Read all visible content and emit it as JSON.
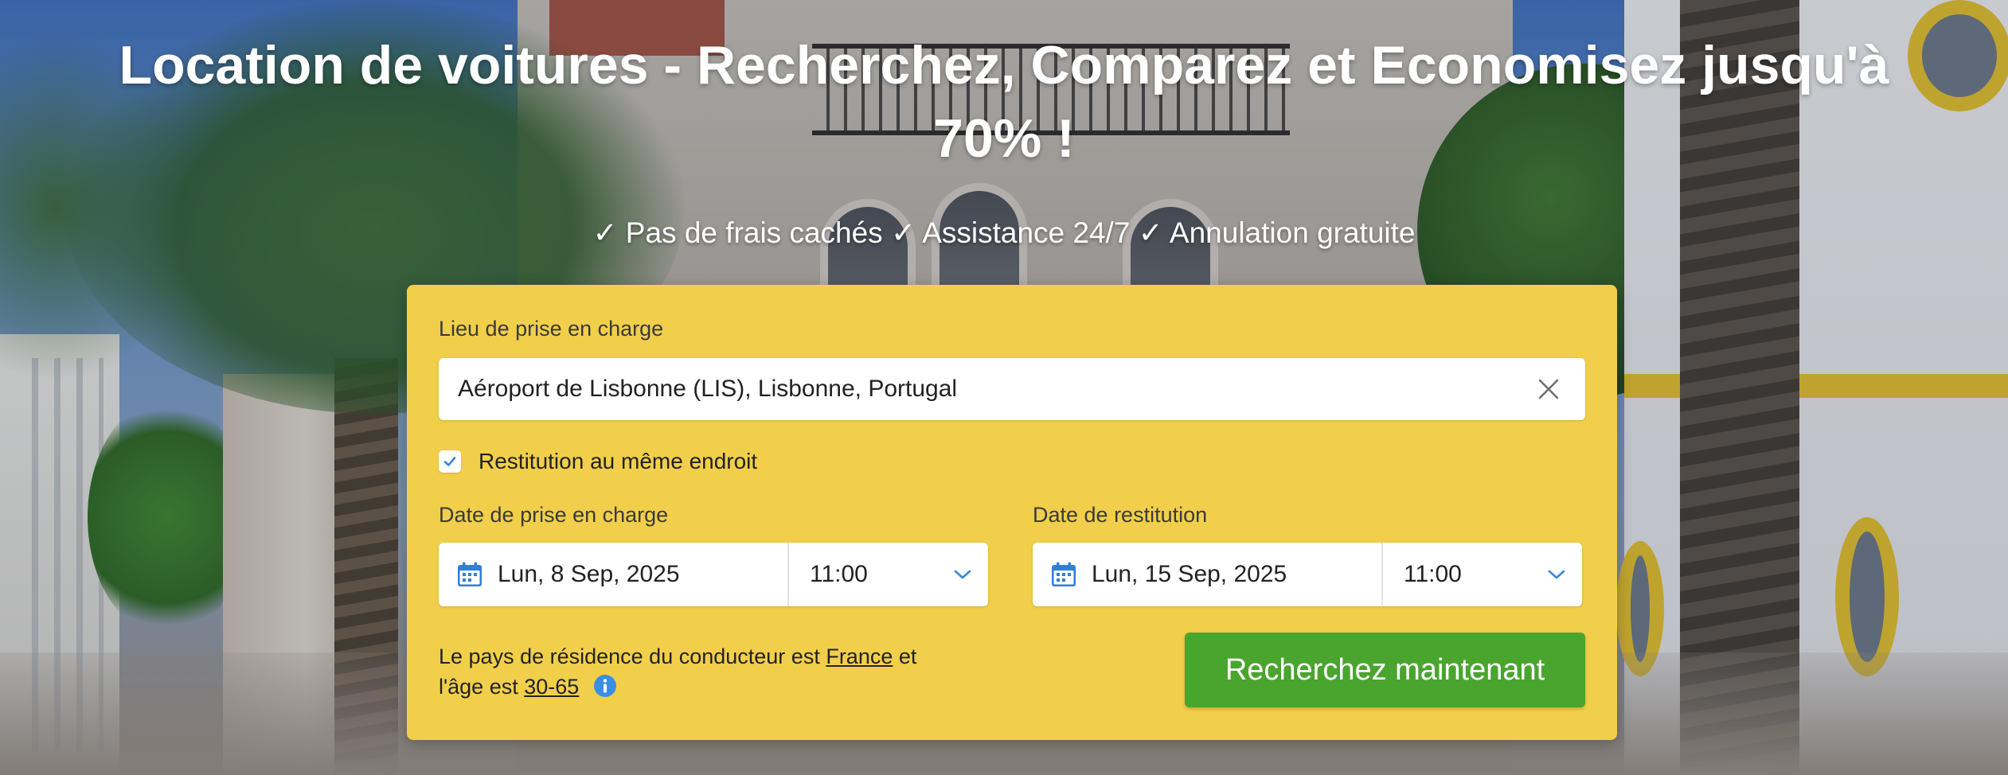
{
  "hero": {
    "title": "Location de voitures - Recherchez, Comparez et Economisez jusqu'à 70% !",
    "benefits": "✓ Pas de frais cachés ✓ Assistance 24/7 ✓ Annulation gratuite"
  },
  "search_form": {
    "pickup_location_label": "Lieu de prise en charge",
    "pickup_location_value": "Aéroport de Lisbonne (LIS), Lisbonne, Portugal",
    "same_return_label": "Restitution au même endroit",
    "same_return_checked": true,
    "pickup_date_label": "Date de prise en charge",
    "pickup_date": "Lun, 8 Sep, 2025",
    "pickup_time": "11:00",
    "return_date_label": "Date de restitution",
    "return_date": "Lun, 15 Sep, 2025",
    "return_time": "11:00",
    "residence_text_before": "Le pays de résidence du conducteur est ",
    "residence_country": "France",
    "residence_text_after": " et",
    "age_text_before": "l'âge est ",
    "age_range": "30-65",
    "search_button_label": "Recherchez maintenant"
  },
  "colors": {
    "panel_background": "#f2cf4a",
    "search_button": "#4aa52e",
    "calendar_icon": "#2f7fd6",
    "info_icon": "#3a8ee6"
  },
  "icons": {
    "clear": "close-icon",
    "checkbox": "checkmark-icon",
    "calendar": "calendar-icon",
    "dropdown": "chevron-down-icon",
    "info": "info-icon"
  }
}
